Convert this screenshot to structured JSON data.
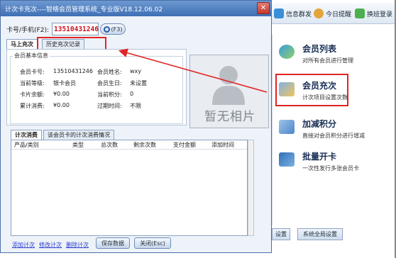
{
  "background": {
    "topbar": {
      "btn1": "信息群发",
      "btn2": "今日提醒",
      "btn3": "换班登录"
    },
    "menu": [
      {
        "title": "会员列表",
        "sub": "对所有会员进行管理"
      },
      {
        "title": "会员充次",
        "sub": "计次项目设置次数"
      },
      {
        "title": "加减积分",
        "sub": "直接对会员积分进行增减"
      },
      {
        "title": "批量开卡",
        "sub": "一次性发行多张会员卡"
      }
    ],
    "bottom": {
      "btn1": "设置",
      "btn2": "系统全局设置"
    }
  },
  "dialog": {
    "title": "计次卡充次----智络会员管理系统_专业版V18.12.06.02",
    "close_label": "✕",
    "card_label": "卡号/手机(F2):",
    "card_value": "13510431246",
    "search_label": "(F3)",
    "tabs_top": [
      "马上充次",
      "历史充次记录"
    ],
    "info": {
      "group_title": "会员基本信息",
      "rows": [
        {
          "k1": "会员卡号:",
          "v1": "13510431246",
          "k2": "会员姓名:",
          "v2": "wxy"
        },
        {
          "k1": "当前等级:",
          "v1": "银卡会员",
          "k2": "会员生日:",
          "v2": "未设置"
        },
        {
          "k1": "卡片余额:",
          "v1": "¥0.00",
          "k2": "当前积分:",
          "v2": "0"
        },
        {
          "k1": "累计消费:",
          "v1": "¥0.00",
          "k2": "过期时间:",
          "v2": "不限"
        }
      ]
    },
    "photo_text": "暂无相片",
    "tabs_mid": [
      "计次消费",
      "该会员卡的计次消费情况"
    ],
    "columns": [
      "产品/类别",
      "类型",
      "总次数",
      "剩余次数",
      "支付金额",
      "添加时间"
    ],
    "links": [
      "添加计次",
      "修改计次",
      "删除计次"
    ],
    "save_label": "保存数据",
    "close_btn_label": "关闭(Esc)"
  },
  "colors": {
    "highlight": "#e02424",
    "title_bar": "#4a79bd",
    "card_value": "#d0101f"
  }
}
